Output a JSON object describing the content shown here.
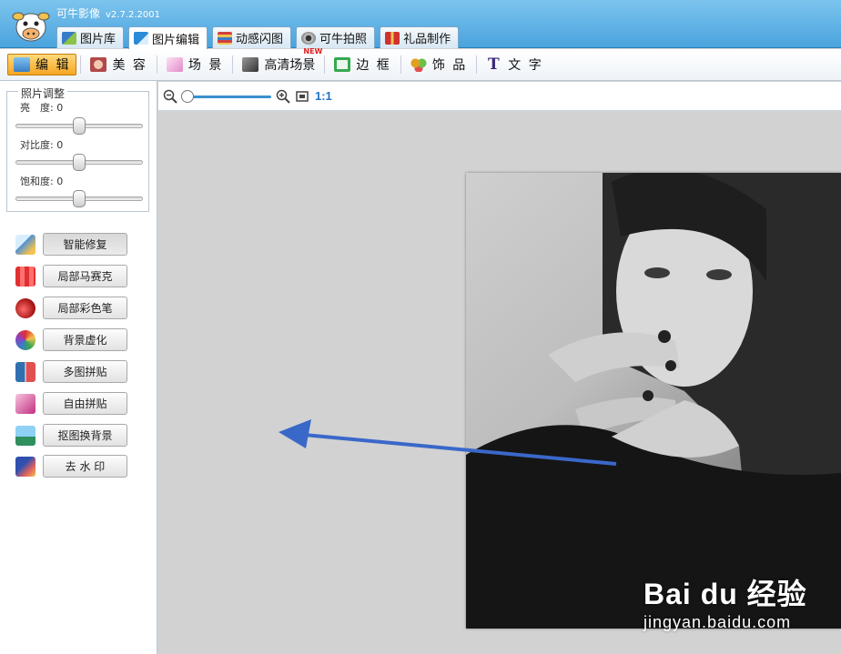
{
  "app": {
    "title": "可牛影像",
    "version": "v2.7.2.2001"
  },
  "tabs": [
    {
      "label": "图片库",
      "icon": "gallery-icon",
      "color": "#3a7bc8"
    },
    {
      "label": "图片编辑",
      "icon": "edit-image-icon",
      "color": "#2b8ad9"
    },
    {
      "label": "动感闪图",
      "icon": "film-icon",
      "color": "#d04040"
    },
    {
      "label": "可牛拍照",
      "icon": "camera-icon",
      "color": "#777777"
    },
    {
      "label": "礼品制作",
      "icon": "gift-icon",
      "color": "#d03030"
    }
  ],
  "toolbar": [
    {
      "label": "编 辑",
      "icon": "edit-icon",
      "color": "#3b7fc4"
    },
    {
      "label": "美 容",
      "icon": "beauty-icon",
      "color": "#b04a4a"
    },
    {
      "label": "场 景",
      "icon": "scene-icon",
      "color": "#e089c8"
    },
    {
      "label": "高清场景",
      "icon": "hd-scene-icon",
      "color": "#5a5a5a",
      "badge": "NEW"
    },
    {
      "label": "边 框",
      "icon": "frame-icon",
      "color": "#36a850"
    },
    {
      "label": "饰 品",
      "icon": "ornament-icon",
      "color": "#e0a020"
    },
    {
      "label": "文 字",
      "icon": "text-icon",
      "color": "#3a2a7a"
    }
  ],
  "adjust": {
    "title": "照片调整",
    "brightness": {
      "label": "亮　度:",
      "value": "0"
    },
    "contrast": {
      "label": "对比度:",
      "value": "0"
    },
    "saturation": {
      "label": "饱和度:",
      "value": "0"
    }
  },
  "functions": [
    {
      "label": "智能修复",
      "icon": "smart-fix-icon",
      "color": "#4a90d9"
    },
    {
      "label": "局部马赛克",
      "icon": "mosaic-icon",
      "color": "#e03030"
    },
    {
      "label": "局部彩色笔",
      "icon": "color-pen-icon",
      "color": "#c02020"
    },
    {
      "label": "背景虚化",
      "icon": "blur-icon",
      "color": "#9040c0"
    },
    {
      "label": "多图拼贴",
      "icon": "multi-collage-icon",
      "color": "#3070b0"
    },
    {
      "label": "自由拼贴",
      "icon": "free-collage-icon",
      "color": "#c03080"
    },
    {
      "label": "抠图换背景",
      "icon": "cutout-icon",
      "color": "#2f8f5f"
    },
    {
      "label": "去 水 印",
      "icon": "remove-watermark-icon",
      "color": "#3050b0"
    }
  ],
  "zoom": {
    "label": "1:1"
  },
  "watermark": {
    "logo": "Bai du 经验",
    "url": "jingyan.baidu.com"
  },
  "colors": {
    "title_bar": "#4aa3dd",
    "active_tool": "#f6a623",
    "arrow": "#3a68c9"
  }
}
